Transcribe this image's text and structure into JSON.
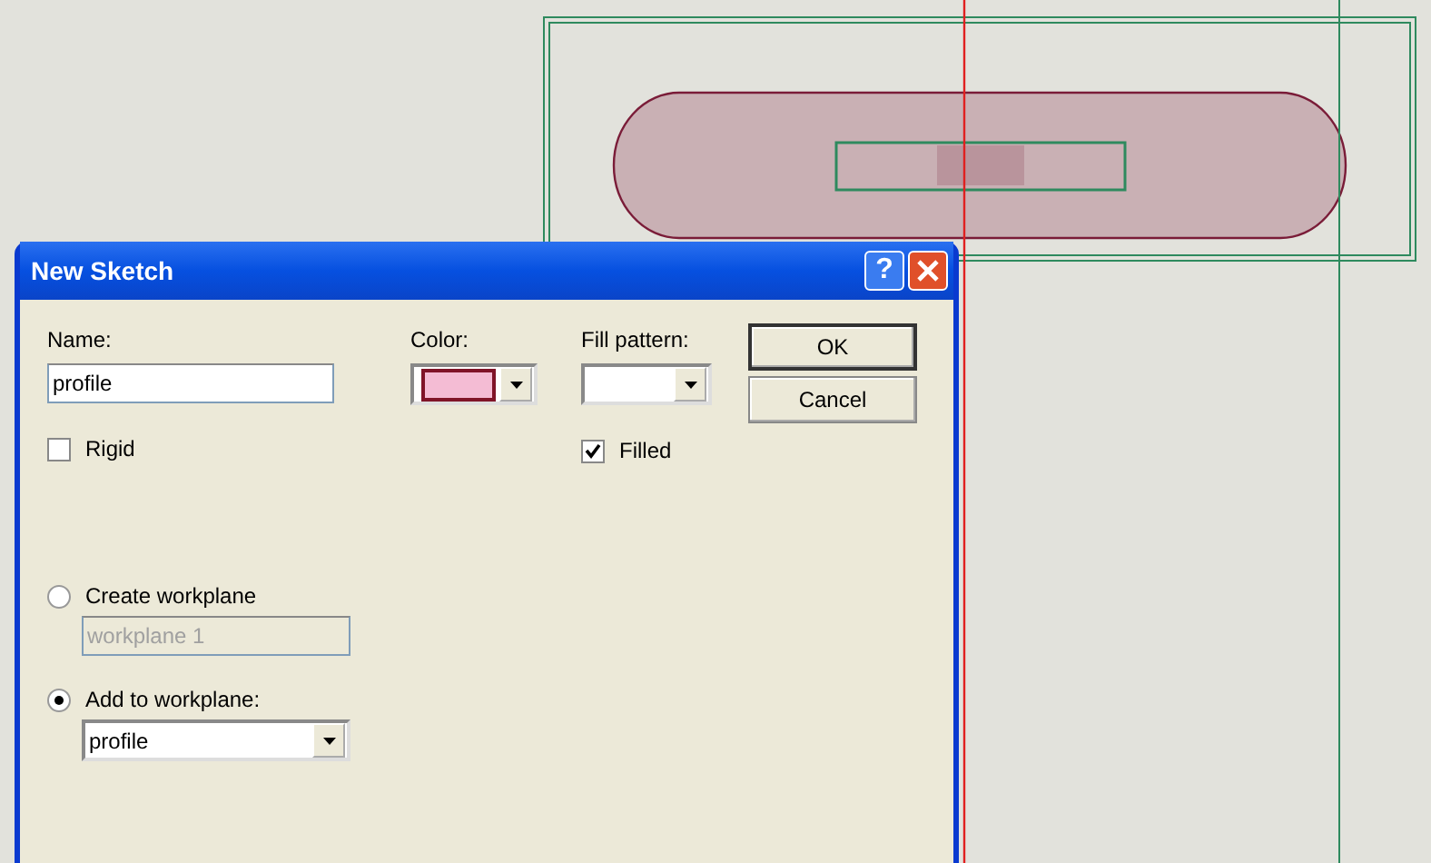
{
  "window": {
    "title": "New Sketch",
    "help": "?"
  },
  "name": {
    "label": "Name:",
    "value": "profile"
  },
  "color": {
    "label": "Color:",
    "color": "#f4bcd4"
  },
  "fill_pattern": {
    "label": "Fill pattern:"
  },
  "checkboxes": [
    {
      "label": "Rigid",
      "checked": false
    },
    {
      "label": "Filled",
      "checked": true
    }
  ],
  "buttons": [
    {
      "label": "OK",
      "default": true
    },
    {
      "label": "Cancel",
      "default": false
    }
  ],
  "workplane_options": [
    {
      "label": "Create workplane",
      "selected": false,
      "field": {
        "value": "workplane 1",
        "disabled": true,
        "kind": "text"
      }
    },
    {
      "label": "Add to workplane:",
      "selected": true,
      "field": {
        "value": "profile",
        "disabled": false,
        "kind": "dropdown"
      }
    }
  ]
}
